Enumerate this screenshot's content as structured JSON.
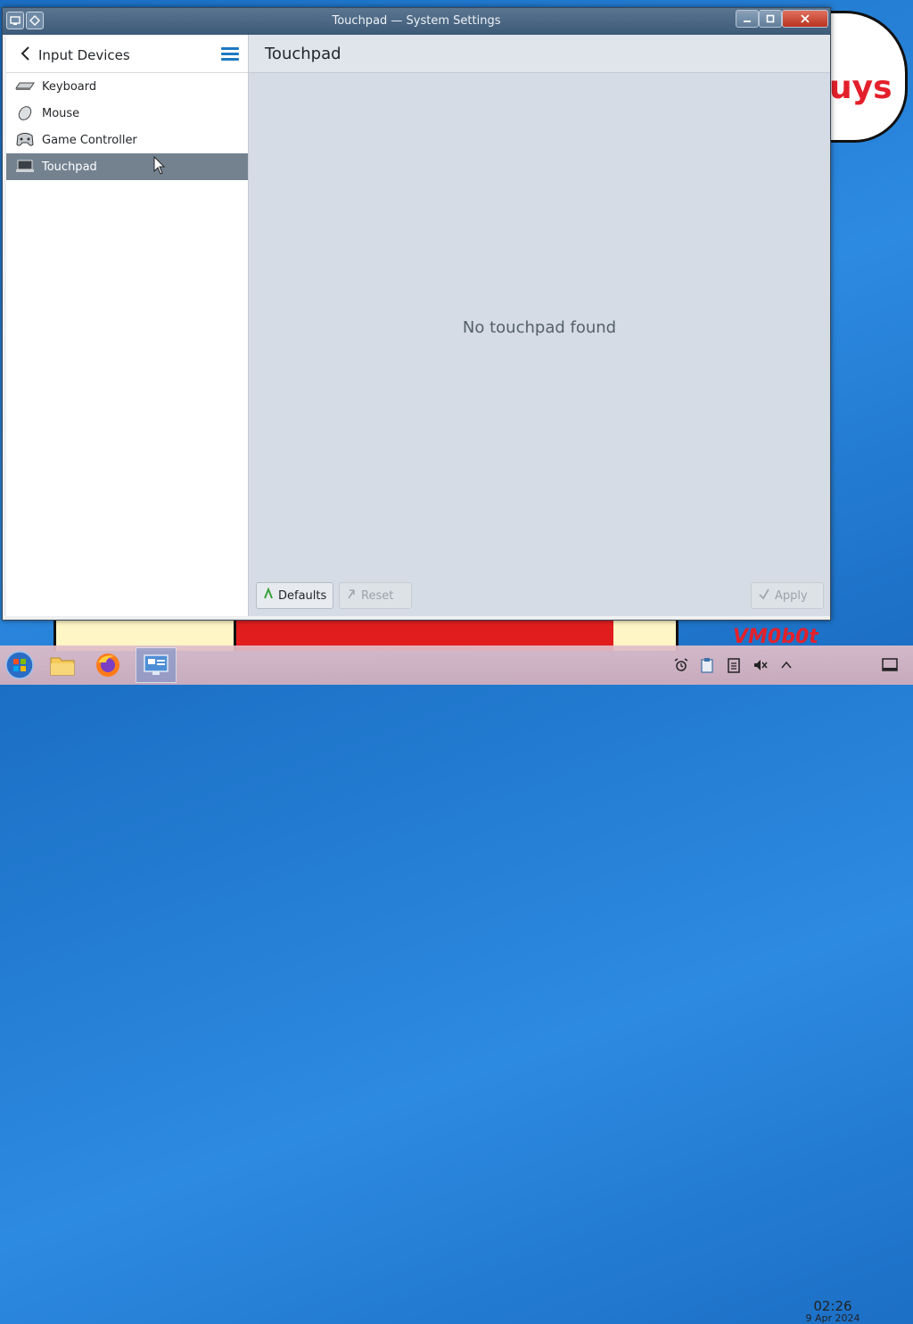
{
  "window": {
    "title": "Touchpad — System Settings"
  },
  "sidebar": {
    "title": "Input Devices",
    "items": [
      {
        "label": "Keyboard",
        "icon": "keyboard-icon"
      },
      {
        "label": "Mouse",
        "icon": "mouse-icon"
      },
      {
        "label": "Game Controller",
        "icon": "gamepad-icon"
      },
      {
        "label": "Touchpad",
        "icon": "touchpad-icon",
        "selected": true
      }
    ]
  },
  "content": {
    "title": "Touchpad",
    "empty_message": "No touchpad found"
  },
  "footer": {
    "defaults_label": "Defaults",
    "reset_label": "Reset",
    "apply_label": "Apply"
  },
  "desktop": {
    "wallpaper_text": "uys",
    "wallpaper_text_2": "VM0b0t"
  },
  "taskbar": {
    "apps": [
      "start-menu-icon",
      "file-manager-icon",
      "firefox-icon",
      "system-settings-icon"
    ],
    "tray": [
      "alarm-icon",
      "clipboard-icon",
      "notes-icon",
      "speaker-muted-icon",
      "chevron-up-icon",
      "show-desktop-icon"
    ],
    "clock_time": "02:26",
    "clock_date": "9 Apr 2024"
  },
  "colors": {
    "selection": "#748290",
    "accent": "#1d79c2",
    "titlebar": "#4a6786"
  }
}
